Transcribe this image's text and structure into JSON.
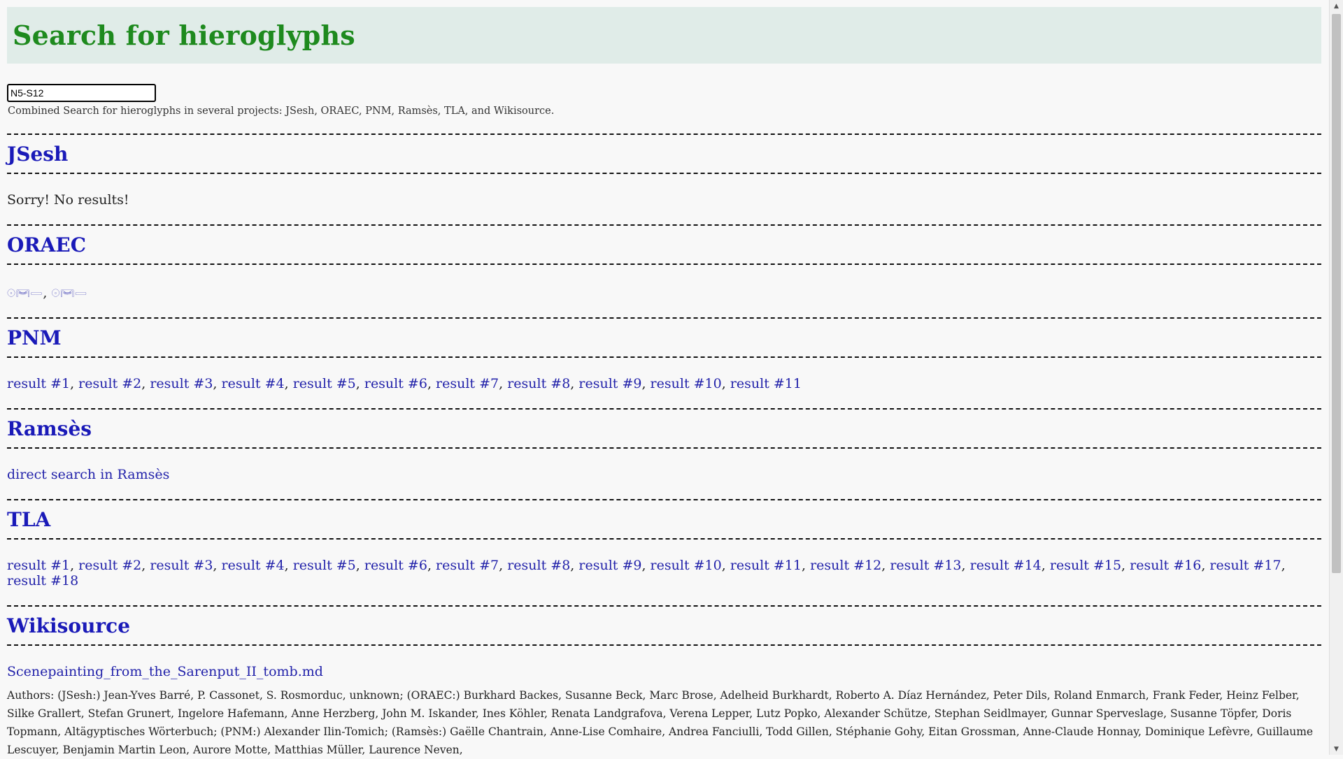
{
  "header": {
    "title": "Search for hieroglyphs"
  },
  "search": {
    "value": "N5-S12"
  },
  "description": "Combined Search for hieroglyphs in several projects: JSesh, ORAEC, PNM, Ramsès, TLA, and Wikisource.",
  "sections": {
    "jsesh": {
      "title": "JSesh",
      "message": "Sorry! No results!"
    },
    "oraec": {
      "title": "ORAEC",
      "glyphs": [
        "𓇳𓋞𓏔",
        "𓇳𓋞𓏔"
      ]
    },
    "pnm": {
      "title": "PNM",
      "results": [
        "result #1",
        "result #2",
        "result #3",
        "result #4",
        "result #5",
        "result #6",
        "result #7",
        "result #8",
        "result #9",
        "result #10",
        "result #11"
      ]
    },
    "ramses": {
      "title": "Ramsès",
      "link": "direct search in Ramsès"
    },
    "tla": {
      "title": "TLA",
      "results": [
        "result #1",
        "result #2",
        "result #3",
        "result #4",
        "result #5",
        "result #6",
        "result #7",
        "result #8",
        "result #9",
        "result #10",
        "result #11",
        "result #12",
        "result #13",
        "result #14",
        "result #15",
        "result #16",
        "result #17",
        "result #18"
      ]
    },
    "wikisource": {
      "title": "Wikisource",
      "link": "Scenepainting_from_the_Sarenput_II_tomb.md",
      "authors": "Authors: (JSesh:) Jean-Yves Barré, P. Cassonet, S. Rosmorduc, unknown; (ORAEC:) Burkhard Backes, Susanne Beck, Marc Brose, Adelheid Burkhardt, Roberto A. Díaz Hernández, Peter Dils, Roland Enmarch, Frank Feder, Heinz Felber, Silke Grallert, Stefan Grunert, Ingelore Hafemann, Anne Herzberg, John M. Iskander, Ines Köhler, Renata Landgrafova, Verena Lepper, Lutz Popko, Alexander Schütze, Stephan Seidlmayer, Gunnar Sperveslage, Susanne Töpfer, Doris Topmann, Altägyptisches Wörterbuch; (PNM:) Alexander Ilin-Tomich; (Ramsès:) Gaëlle Chantrain, Anne-Lise Comhaire, Andrea Fanciulli, Todd Gillen, Stéphanie Gohy, Eitan Grossman, Anne-Claude Honnay, Dominique Lefèvre, Guillaume Lescuyer, Benjamin Martin Leon, Aurore Motte, Matthias Müller, Laurence Neven,"
    }
  }
}
